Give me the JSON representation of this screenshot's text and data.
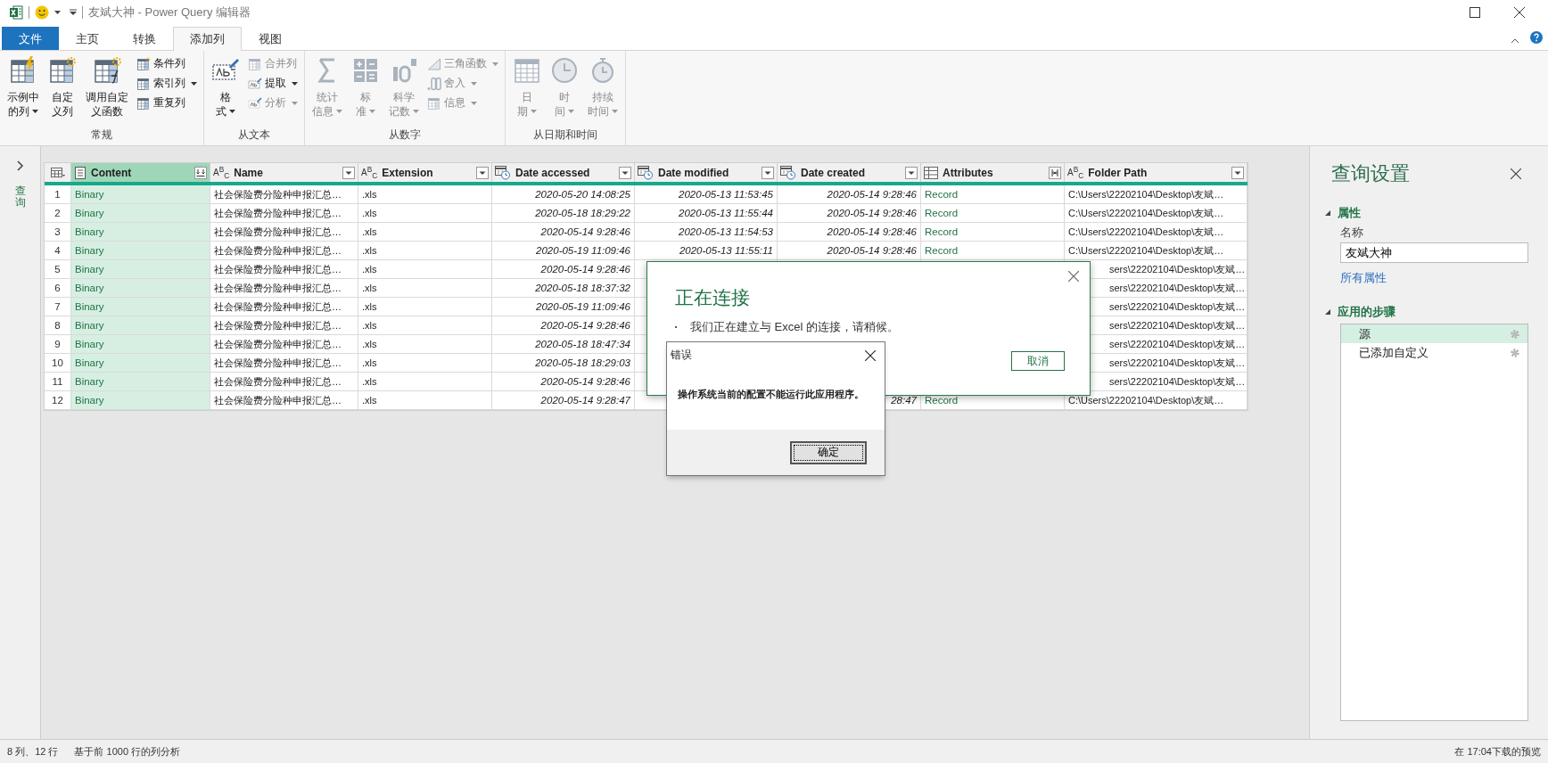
{
  "window": {
    "title": "友斌大神 - Power Query 编辑器"
  },
  "ribbon_tabs": [
    {
      "label": "文件",
      "kind": "file",
      "selected": false
    },
    {
      "label": "主页",
      "kind": "tab",
      "selected": false
    },
    {
      "label": "转换",
      "kind": "tab",
      "selected": false
    },
    {
      "label": "添加列",
      "kind": "tab",
      "selected": true
    },
    {
      "label": "视图",
      "kind": "tab",
      "selected": false
    }
  ],
  "ribbon": {
    "groups": [
      {
        "label": "常规",
        "items": [
          {
            "kind": "large",
            "lines": [
              "示例中",
              "的列"
            ],
            "dropdown": true,
            "disabled": false
          },
          {
            "kind": "large",
            "lines": [
              "自定",
              "义列"
            ],
            "dropdown": false,
            "disabled": false
          },
          {
            "kind": "large",
            "lines": [
              "调用自定",
              "义函数"
            ],
            "dropdown": false,
            "disabled": false
          },
          {
            "kind": "small",
            "label": "条件列",
            "dropdown": false,
            "disabled": false
          },
          {
            "kind": "small",
            "label": "索引列",
            "dropdown": true,
            "disabled": false
          },
          {
            "kind": "small",
            "label": "重复列",
            "dropdown": false,
            "disabled": false
          }
        ]
      },
      {
        "label": "从文本",
        "items": [
          {
            "kind": "large",
            "lines": [
              "格",
              "式"
            ],
            "dropdown": true,
            "disabled": false
          },
          {
            "kind": "small",
            "label": "合并列",
            "dropdown": false,
            "disabled": true
          },
          {
            "kind": "small",
            "label": "提取",
            "dropdown": true,
            "disabled": false
          },
          {
            "kind": "small",
            "label": "分析",
            "dropdown": true,
            "disabled": true
          }
        ]
      },
      {
        "label": "从数字",
        "items": [
          {
            "kind": "large",
            "lines": [
              "统计",
              "信息"
            ],
            "dropdown": true,
            "disabled": true
          },
          {
            "kind": "large",
            "lines": [
              "标",
              "准"
            ],
            "dropdown": true,
            "disabled": true
          },
          {
            "kind": "large",
            "lines": [
              "科学",
              "记数"
            ],
            "dropdown": true,
            "disabled": true
          },
          {
            "kind": "small",
            "label": "三角函数",
            "dropdown": true,
            "disabled": true
          },
          {
            "kind": "small",
            "label": "舍入",
            "dropdown": true,
            "disabled": true
          },
          {
            "kind": "small",
            "label": "信息",
            "dropdown": true,
            "disabled": true
          }
        ]
      },
      {
        "label": "从日期和时间",
        "items": [
          {
            "kind": "large",
            "lines": [
              "日",
              "期"
            ],
            "dropdown": true,
            "disabled": true
          },
          {
            "kind": "large",
            "lines": [
              "时",
              "间"
            ],
            "dropdown": true,
            "disabled": true
          },
          {
            "kind": "large",
            "lines": [
              "持续",
              "时间"
            ],
            "dropdown": true,
            "disabled": true
          }
        ]
      }
    ]
  },
  "queries_pane": {
    "label": "查询"
  },
  "table": {
    "columns": [
      {
        "label": "Content",
        "kind": "binary",
        "button": {
          "kind": "combine"
        },
        "selected": true
      },
      {
        "label": "Name",
        "kind": "text",
        "type_label": "A$^{B}$$_{C}$",
        "button": {
          "kind": "filter"
        },
        "selected": false
      },
      {
        "label": "Extension",
        "kind": "text",
        "type_label": "A$^{B}$$_{C}$",
        "button": {
          "kind": "filter"
        },
        "selected": false
      },
      {
        "label": "Date accessed",
        "kind": "datetime",
        "button": {
          "kind": "filter"
        },
        "selected": false
      },
      {
        "label": "Date modified",
        "kind": "datetime",
        "button": {
          "kind": "filter"
        },
        "selected": false
      },
      {
        "label": "Date created",
        "kind": "datetime",
        "button": {
          "kind": "filter"
        },
        "selected": false
      },
      {
        "label": "Attributes",
        "kind": "record",
        "button": {
          "kind": "expand"
        },
        "selected": false
      },
      {
        "label": "Folder Path",
        "kind": "text",
        "type_label": "A$^{B}$$_{C}$",
        "button": {
          "kind": "filter"
        },
        "selected": false
      }
    ],
    "rows": [
      {
        "num": "1",
        "covered": false,
        "cells": [
          "Binary",
          "社会保险费分险种申报汇总…",
          ".xls",
          "2020-05-20 14:08:25",
          "2020-05-13 11:53:45",
          "2020-05-14 9:28:46",
          "Record",
          "C:\\Users\\22202104\\Desktop\\友斌…"
        ]
      },
      {
        "num": "2",
        "covered": false,
        "cells": [
          "Binary",
          "社会保险费分险种申报汇总…",
          ".xls",
          "2020-05-18 18:29:22",
          "2020-05-13 11:55:44",
          "2020-05-14 9:28:46",
          "Record",
          "C:\\Users\\22202104\\Desktop\\友斌…"
        ]
      },
      {
        "num": "3",
        "covered": false,
        "cells": [
          "Binary",
          "社会保险费分险种申报汇总…",
          ".xls",
          "2020-05-14 9:28:46",
          "2020-05-13 11:54:53",
          "2020-05-14 9:28:46",
          "Record",
          "C:\\Users\\22202104\\Desktop\\友斌…"
        ]
      },
      {
        "num": "4",
        "covered": false,
        "cells": [
          "Binary",
          "社会保险费分险种申报汇总…",
          ".xls",
          "2020-05-19 11:09:46",
          "2020-05-13 11:55:11",
          "2020-05-14 9:28:46",
          "Record",
          "C:\\Users\\22202104\\Desktop\\友斌…"
        ]
      },
      {
        "num": "5",
        "covered": true,
        "cells": [
          "Binary",
          "社会保险费分险种申报汇总…",
          ".xls",
          "2020-05-14 9:28:46",
          null,
          null,
          null,
          "sers\\22202104\\Desktop\\友斌…"
        ]
      },
      {
        "num": "6",
        "covered": true,
        "cells": [
          "Binary",
          "社会保险费分险种申报汇总…",
          ".xls",
          "2020-05-18 18:37:32",
          null,
          null,
          null,
          "sers\\22202104\\Desktop\\友斌…"
        ]
      },
      {
        "num": "7",
        "covered": true,
        "cells": [
          "Binary",
          "社会保险费分险种申报汇总…",
          ".xls",
          "2020-05-19 11:09:46",
          null,
          null,
          null,
          "sers\\22202104\\Desktop\\友斌…"
        ]
      },
      {
        "num": "8",
        "covered": true,
        "cells": [
          "Binary",
          "社会保险费分险种申报汇总…",
          ".xls",
          "2020-05-14 9:28:46",
          null,
          null,
          null,
          "sers\\22202104\\Desktop\\友斌…"
        ]
      },
      {
        "num": "9",
        "covered": true,
        "cells": [
          "Binary",
          "社会保险费分险种申报汇总…",
          ".xls",
          "2020-05-18 18:47:34",
          null,
          null,
          null,
          "sers\\22202104\\Desktop\\友斌…"
        ]
      },
      {
        "num": "10",
        "covered": true,
        "cells": [
          "Binary",
          "社会保险费分险种申报汇总…",
          ".xls",
          "2020-05-18 18:29:03",
          null,
          null,
          null,
          "sers\\22202104\\Desktop\\友斌…"
        ]
      },
      {
        "num": "11",
        "covered": true,
        "cells": [
          "Binary",
          "社会保险费分险种申报汇总…",
          ".xls",
          "2020-05-14 9:28:46",
          null,
          null,
          null,
          "sers\\22202104\\Desktop\\友斌…"
        ]
      },
      {
        "num": "12",
        "covered": false,
        "cells": [
          "Binary",
          "社会保险费分险种申报汇总…",
          ".xls",
          "2020-05-14 9:28:47",
          null,
          "28:47",
          "Record",
          "C:\\Users\\22202104\\Desktop\\友斌…"
        ]
      }
    ]
  },
  "query_settings": {
    "title": "查询设置",
    "properties_heading": "属性",
    "name_label": "名称",
    "name_value": "友斌大神",
    "all_properties_link": "所有属性",
    "steps_heading": "应用的步骤",
    "steps": [
      {
        "label": "源",
        "selected": true
      },
      {
        "label": "已添加自定义",
        "selected": false
      }
    ]
  },
  "connecting_dialog": {
    "title": "正在连接",
    "message": "我们正在建立与 Excel 的连接，请稍候。",
    "cancel_button": "取消"
  },
  "error_dialog": {
    "title": "错误",
    "message": "操作系统当前的配置不能运行此应用程序。",
    "ok_button": "确定"
  },
  "status_bar": {
    "left": "8 列、12 行",
    "middle": "基于前 1000 行的列分析",
    "right": "在 17:04下载的预览"
  }
}
